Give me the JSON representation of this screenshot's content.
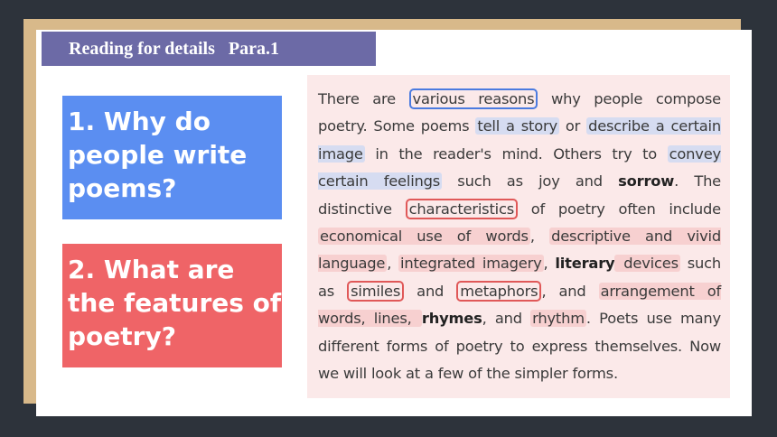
{
  "title": "Reading for details   Para.1",
  "questions": [
    {
      "text": "1. Why do people write poems?"
    },
    {
      "text": "2. What are the features of poetry?"
    }
  ],
  "passage": [
    {
      "t": "There are ",
      "s": "plain"
    },
    {
      "t": "various reasons",
      "s": "box-blue"
    },
    {
      "t": " why people compose poetry. Some poems ",
      "s": "plain"
    },
    {
      "t": "tell a story",
      "s": "hl-blue"
    },
    {
      "t": " or ",
      "s": "plain"
    },
    {
      "t": "describe a certain image",
      "s": "hl-blue"
    },
    {
      "t": " in the reader's mind. Others try to ",
      "s": "plain"
    },
    {
      "t": "convey certain feelings",
      "s": "hl-blue"
    },
    {
      "t": " such as joy and ",
      "s": "plain"
    },
    {
      "t": "sorrow",
      "s": "bold"
    },
    {
      "t": ". The distinctive ",
      "s": "plain"
    },
    {
      "t": "characteristics",
      "s": "box-red"
    },
    {
      "t": " of poetry often include ",
      "s": "plain"
    },
    {
      "t": "economical use of words",
      "s": "hl-red"
    },
    {
      "t": ", ",
      "s": "plain"
    },
    {
      "t": "descriptive and vivid language",
      "s": "hl-red"
    },
    {
      "t": ", ",
      "s": "plain"
    },
    {
      "t": "integrated imagery",
      "s": "hl-red"
    },
    {
      "t": ", ",
      "s": "plain"
    },
    {
      "t": "literary",
      "s": "bold"
    },
    {
      "t": " devices",
      "s": "hl-red"
    },
    {
      "t": " such as ",
      "s": "plain"
    },
    {
      "t": "similes",
      "s": "box-red"
    },
    {
      "t": " and ",
      "s": "plain"
    },
    {
      "t": "metaphors",
      "s": "box-red"
    },
    {
      "t": ", and ",
      "s": "plain"
    },
    {
      "t": "arrangement of words, lines, ",
      "s": "hl-red"
    },
    {
      "t": "rhymes",
      "s": "bold"
    },
    {
      "t": ", and ",
      "s": "plain"
    },
    {
      "t": "rhythm",
      "s": "hl-red"
    },
    {
      "t": ". Poets use many different forms of poetry to express themselves. Now we will look at a few of the simpler forms.",
      "s": "plain"
    }
  ],
  "colors": {
    "title_bg": "#6c6aa6",
    "q1_bg": "#5b8ef1",
    "q2_bg": "#ef6467",
    "passage_bg": "#fbe9e9"
  }
}
